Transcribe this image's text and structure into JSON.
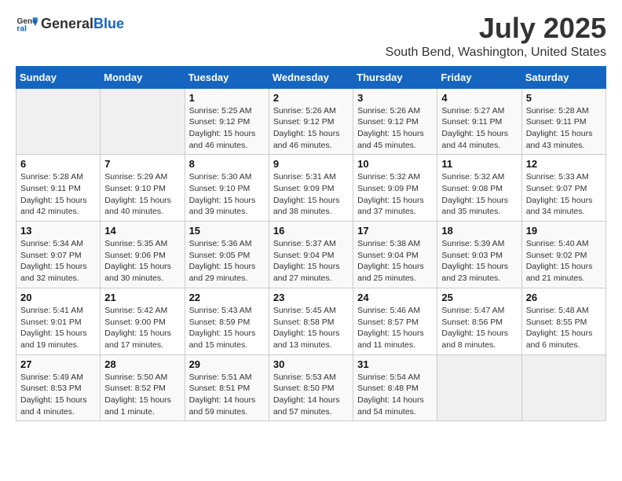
{
  "logo": {
    "text_general": "General",
    "text_blue": "Blue"
  },
  "title": "July 2025",
  "subtitle": "South Bend, Washington, United States",
  "headers": [
    "Sunday",
    "Monday",
    "Tuesday",
    "Wednesday",
    "Thursday",
    "Friday",
    "Saturday"
  ],
  "weeks": [
    [
      {
        "day": "",
        "info": ""
      },
      {
        "day": "",
        "info": ""
      },
      {
        "day": "1",
        "info": "Sunrise: 5:25 AM\nSunset: 9:12 PM\nDaylight: 15 hours and 46 minutes."
      },
      {
        "day": "2",
        "info": "Sunrise: 5:26 AM\nSunset: 9:12 PM\nDaylight: 15 hours and 46 minutes."
      },
      {
        "day": "3",
        "info": "Sunrise: 5:26 AM\nSunset: 9:12 PM\nDaylight: 15 hours and 45 minutes."
      },
      {
        "day": "4",
        "info": "Sunrise: 5:27 AM\nSunset: 9:11 PM\nDaylight: 15 hours and 44 minutes."
      },
      {
        "day": "5",
        "info": "Sunrise: 5:28 AM\nSunset: 9:11 PM\nDaylight: 15 hours and 43 minutes."
      }
    ],
    [
      {
        "day": "6",
        "info": "Sunrise: 5:28 AM\nSunset: 9:11 PM\nDaylight: 15 hours and 42 minutes."
      },
      {
        "day": "7",
        "info": "Sunrise: 5:29 AM\nSunset: 9:10 PM\nDaylight: 15 hours and 40 minutes."
      },
      {
        "day": "8",
        "info": "Sunrise: 5:30 AM\nSunset: 9:10 PM\nDaylight: 15 hours and 39 minutes."
      },
      {
        "day": "9",
        "info": "Sunrise: 5:31 AM\nSunset: 9:09 PM\nDaylight: 15 hours and 38 minutes."
      },
      {
        "day": "10",
        "info": "Sunrise: 5:32 AM\nSunset: 9:09 PM\nDaylight: 15 hours and 37 minutes."
      },
      {
        "day": "11",
        "info": "Sunrise: 5:32 AM\nSunset: 9:08 PM\nDaylight: 15 hours and 35 minutes."
      },
      {
        "day": "12",
        "info": "Sunrise: 5:33 AM\nSunset: 9:07 PM\nDaylight: 15 hours and 34 minutes."
      }
    ],
    [
      {
        "day": "13",
        "info": "Sunrise: 5:34 AM\nSunset: 9:07 PM\nDaylight: 15 hours and 32 minutes."
      },
      {
        "day": "14",
        "info": "Sunrise: 5:35 AM\nSunset: 9:06 PM\nDaylight: 15 hours and 30 minutes."
      },
      {
        "day": "15",
        "info": "Sunrise: 5:36 AM\nSunset: 9:05 PM\nDaylight: 15 hours and 29 minutes."
      },
      {
        "day": "16",
        "info": "Sunrise: 5:37 AM\nSunset: 9:04 PM\nDaylight: 15 hours and 27 minutes."
      },
      {
        "day": "17",
        "info": "Sunrise: 5:38 AM\nSunset: 9:04 PM\nDaylight: 15 hours and 25 minutes."
      },
      {
        "day": "18",
        "info": "Sunrise: 5:39 AM\nSunset: 9:03 PM\nDaylight: 15 hours and 23 minutes."
      },
      {
        "day": "19",
        "info": "Sunrise: 5:40 AM\nSunset: 9:02 PM\nDaylight: 15 hours and 21 minutes."
      }
    ],
    [
      {
        "day": "20",
        "info": "Sunrise: 5:41 AM\nSunset: 9:01 PM\nDaylight: 15 hours and 19 minutes."
      },
      {
        "day": "21",
        "info": "Sunrise: 5:42 AM\nSunset: 9:00 PM\nDaylight: 15 hours and 17 minutes."
      },
      {
        "day": "22",
        "info": "Sunrise: 5:43 AM\nSunset: 8:59 PM\nDaylight: 15 hours and 15 minutes."
      },
      {
        "day": "23",
        "info": "Sunrise: 5:45 AM\nSunset: 8:58 PM\nDaylight: 15 hours and 13 minutes."
      },
      {
        "day": "24",
        "info": "Sunrise: 5:46 AM\nSunset: 8:57 PM\nDaylight: 15 hours and 11 minutes."
      },
      {
        "day": "25",
        "info": "Sunrise: 5:47 AM\nSunset: 8:56 PM\nDaylight: 15 hours and 8 minutes."
      },
      {
        "day": "26",
        "info": "Sunrise: 5:48 AM\nSunset: 8:55 PM\nDaylight: 15 hours and 6 minutes."
      }
    ],
    [
      {
        "day": "27",
        "info": "Sunrise: 5:49 AM\nSunset: 8:53 PM\nDaylight: 15 hours and 4 minutes."
      },
      {
        "day": "28",
        "info": "Sunrise: 5:50 AM\nSunset: 8:52 PM\nDaylight: 15 hours and 1 minute."
      },
      {
        "day": "29",
        "info": "Sunrise: 5:51 AM\nSunset: 8:51 PM\nDaylight: 14 hours and 59 minutes."
      },
      {
        "day": "30",
        "info": "Sunrise: 5:53 AM\nSunset: 8:50 PM\nDaylight: 14 hours and 57 minutes."
      },
      {
        "day": "31",
        "info": "Sunrise: 5:54 AM\nSunset: 8:48 PM\nDaylight: 14 hours and 54 minutes."
      },
      {
        "day": "",
        "info": ""
      },
      {
        "day": "",
        "info": ""
      }
    ]
  ]
}
